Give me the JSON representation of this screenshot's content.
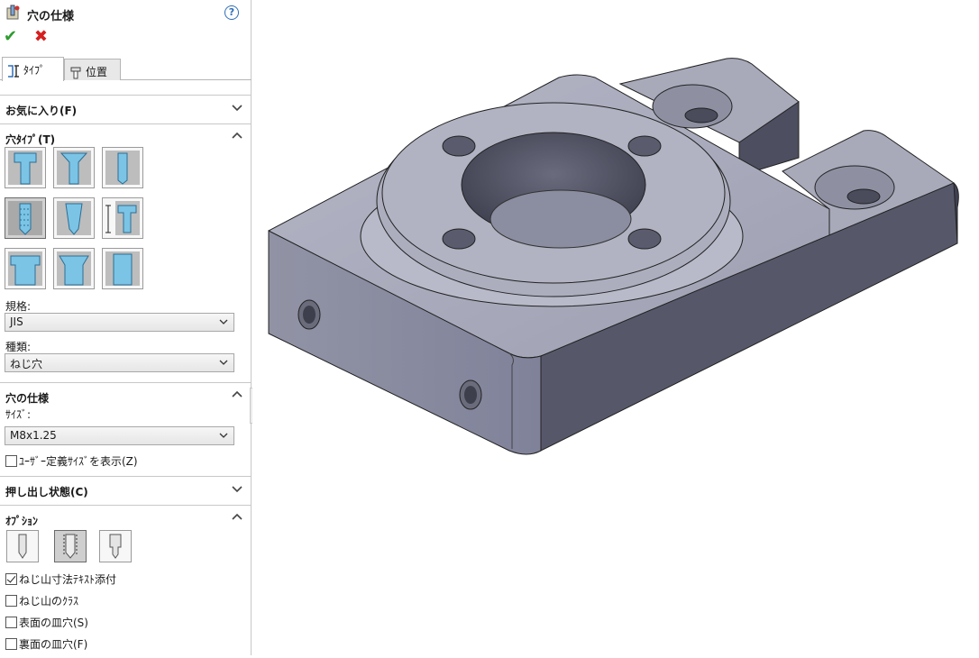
{
  "panel": {
    "title": "穴の仕様",
    "help_icon": "?",
    "ok_icon": "✔",
    "cancel_icon": "✖",
    "tabs": [
      {
        "label": "ﾀｲﾌﾟ",
        "icon": "hole-type-icon"
      },
      {
        "label": "位置",
        "icon": "position-icon"
      }
    ],
    "favorites": {
      "label": "お気に入り(F)"
    },
    "hole_type": {
      "label": "穴ﾀｲﾌﾟ(T)",
      "types": [
        "counterbore",
        "countersink",
        "hole",
        "straight-tap",
        "tapered-tap",
        "legacy-hole",
        "counterbore-slot",
        "countersink-slot",
        "slot"
      ],
      "selected_index": 3
    },
    "standard": {
      "label": "規格:",
      "value": "JIS"
    },
    "kind": {
      "label": "種類:",
      "value": "ねじ穴"
    },
    "hole_spec": {
      "label": "穴の仕様",
      "size_label": "ｻｲｽﾞ:",
      "size_value": "M8x1.25",
      "custom_size_label": "ﾕｰｻﾞｰ定義ｻｲｽﾞを表示(Z)",
      "custom_size_checked": false
    },
    "end_condition": {
      "label": "押し出し状態(C)"
    },
    "options": {
      "label": "ｵﾌﾟｼｮﾝ",
      "buttons": [
        "tap-drill-icon",
        "cosmetic-thread-icon",
        "remove-thread-icon"
      ],
      "selected_index": 1,
      "checkboxes": [
        {
          "label": "ねじ山寸法ﾃｷｽﾄ添付",
          "checked": true
        },
        {
          "label": "ねじ山のｸﾗｽ",
          "checked": false
        },
        {
          "label": "表面の皿穴(S)",
          "checked": false
        },
        {
          "label": "裏面の皿穴(F)",
          "checked": false
        }
      ]
    }
  },
  "colors": {
    "part_top": "#a9abbc",
    "part_side": "#56586a",
    "part_front": "#8a8c9e",
    "accent_blue": "#2d6fb8",
    "ok_green": "#2e9b2e",
    "cancel_red": "#d42020"
  }
}
